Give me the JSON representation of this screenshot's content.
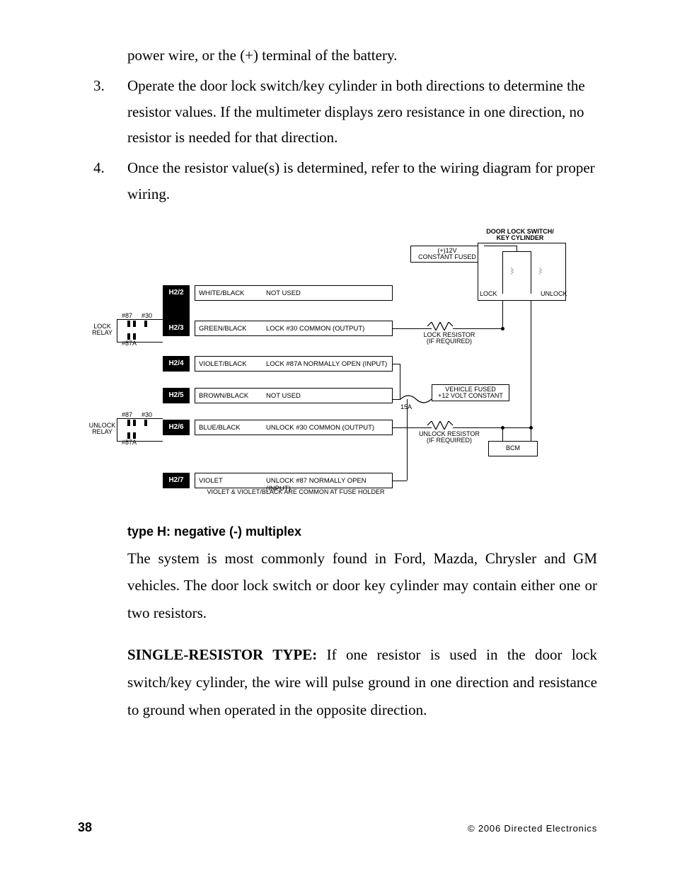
{
  "text": {
    "topline": "power wire, or the (+) terminal of the battery.",
    "item3_num": "3.",
    "item3": "Operate the door lock switch/key cylinder in both directions to determine the resistor values. If the multimeter displays zero resistance in one direction, no resistor is needed for that direction.",
    "item4_num": "4.",
    "item4": "Once the resistor value(s) is determined, refer to the wiring diagram for proper wiring.",
    "subhead": "type H: negative (-) multiplex",
    "para1": "The system is most commonly found in Ford, Mazda, Chrysler and GM vehicles. The door lock switch or door key cylinder may contain either one or two resistors.",
    "para2_lead": "SINGLE-RESISTOR TYPE: ",
    "para2": "If one resistor is used in the door lock switch/key cylinder, the wire will pulse ground in one direction and resistance to ground when operated in the opposite direction."
  },
  "footer": {
    "page": "38",
    "copyright": "© 2006 Directed Electronics"
  },
  "diagram": {
    "title_top": "DOOR LOCK SWITCH/\nKEY CYLINDER",
    "constant_fused": "(+)12V\nCONSTANT FUSED",
    "lock": "LOCK",
    "unlock": "UNLOCK",
    "lock_relay": "LOCK\nRELAY",
    "unlock_relay": "UNLOCK\nRELAY",
    "p87": "#87",
    "p30": "#30",
    "p87a": "#87A",
    "lock_resistor": "LOCK RESISTOR\n(IF REQUIRED)",
    "unlock_resistor": "UNLOCK RESISTOR\n(IF REQUIRED)",
    "vehicle_fused": "VEHICLE FUSED\n+12 VOLT CONSTANT",
    "fuse_15a": "15A",
    "bcm": "BCM",
    "common_note": "VIOLET & VIOLET/BLACK ARE COMMON AT FUSE HOLDER",
    "pins": {
      "h22": "H2/2",
      "h23": "H2/3",
      "h24": "H2/4",
      "h25": "H2/5",
      "h26": "H2/6",
      "h27": "H2/7"
    },
    "wires": {
      "h22_color": "WHITE/BLACK",
      "h22_label": "NOT USED",
      "h23_color": "GREEN/BLACK",
      "h23_label": "LOCK #30 COMMON (OUTPUT)",
      "h24_color": "VIOLET/BLACK",
      "h24_label": "LOCK #87A NORMALLY OPEN (INPUT)",
      "h25_color": "BROWN/BLACK",
      "h25_label": "NOT USED",
      "h26_color": "BLUE/BLACK",
      "h26_label": "UNLOCK #30 COMMON (OUTPUT)",
      "h27_color": "VIOLET",
      "h27_label": "UNLOCK #87 NORMALLY OPEN (INPUT)"
    }
  }
}
